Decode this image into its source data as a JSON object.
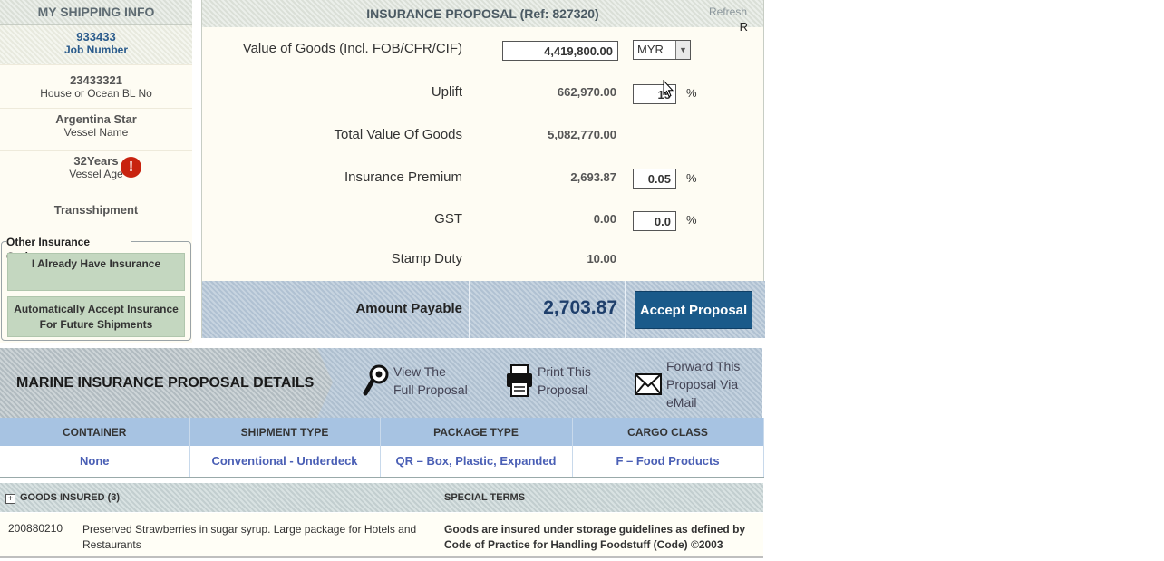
{
  "shipping": {
    "title": "MY SHIPPING INFO",
    "job_number": "933433",
    "job_label": "Job Number",
    "bl_number": "23433321",
    "bl_label": "House or Ocean BL No",
    "vessel_name": "Argentina Star",
    "vessel_label": "Vessel Name",
    "vessel_age": "32Years",
    "vessel_age_label": "Vessel Age",
    "alert_glyph": "!",
    "transshipment": "Transshipment",
    "other_title": "Other Insurance Options",
    "btn_have": "I Already Have Insurance",
    "btn_auto": "Automatically Accept Insurance For Future Shipments"
  },
  "proposal": {
    "title": "INSURANCE PROPOSAL (Ref: 827320)",
    "refresh": "Refresh",
    "refresh_r": "R",
    "rows": [
      {
        "label": "Value of Goods (Incl. FOB/CFR/CIF)",
        "input": "4,419,800.00"
      },
      {
        "label": "Uplift",
        "value": "662,970.00",
        "input": "15"
      },
      {
        "label": "Total Value Of Goods",
        "value": "5,082,770.00"
      },
      {
        "label": "Insurance Premium",
        "value": "2,693.87",
        "input": "0.05"
      },
      {
        "label": "GST",
        "value": "0.00",
        "input": "0.0"
      },
      {
        "label": "Stamp Duty",
        "value": "10.00"
      }
    ],
    "percent": "%",
    "currency": "MYR",
    "amount_label": "Amount Payable",
    "amount_value": "2,703.87",
    "accept": "Accept Proposal"
  },
  "details": {
    "title": "MARINE INSURANCE PROPOSAL DETAILS",
    "view_line1": "View The",
    "view_line2": "Full Proposal",
    "print_line1": "Print This",
    "print_line2": "Proposal",
    "forward_line1": "Forward This",
    "forward_line2": "Proposal Via",
    "forward_line3": "eMail",
    "headers": [
      "CONTAINER",
      "SHIPMENT TYPE",
      "PACKAGE TYPE",
      "CARGO CLASS"
    ],
    "values": [
      "None",
      "Conventional - Underdeck",
      "QR – Box, Plastic, Expanded",
      "F – Food Products"
    ]
  },
  "goods": {
    "title": "GOODS INSURED (3)",
    "special_title": "SPECIAL TERMS",
    "item_id": "200880210",
    "item_desc": "Preserved Strawberries in sugar syrup. Large package for Hotels and Restaurants",
    "terms": "Goods are insured under storage guidelines as defined by Code of Practice for Handling Foodstuff (Code) ©2003"
  },
  "colors": {
    "accent": "#1a5a8a",
    "blue_band": "#b4c5d6",
    "table_header": "#a7c3e2",
    "alert": "#c8230f"
  }
}
